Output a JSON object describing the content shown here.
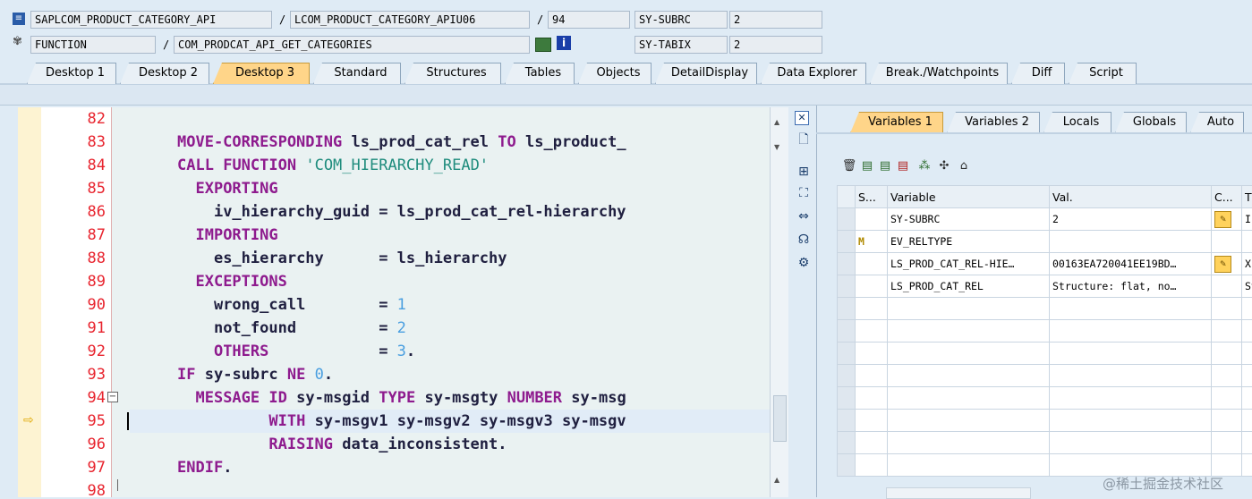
{
  "header": {
    "row1": {
      "program": "SAPLCOM_PRODUCT_CATEGORY_API",
      "include": "LCOM_PRODUCT_CATEGORY_APIU06",
      "line": "94",
      "sysfield": "SY-SUBRC",
      "sysvalue": "2"
    },
    "row2": {
      "type": "FUNCTION",
      "function": "COM_PRODCAT_API_GET_CATEGORIES",
      "sysfield": "SY-TABIX",
      "sysvalue": "2"
    },
    "slash": "/"
  },
  "tabs": [
    {
      "label": "Desktop 1",
      "active": false
    },
    {
      "label": "Desktop 2",
      "active": false
    },
    {
      "label": "Desktop 3",
      "active": true
    },
    {
      "label": "Standard",
      "active": false
    },
    {
      "label": "Structures",
      "active": false
    },
    {
      "label": "Tables",
      "active": false
    },
    {
      "label": "Objects",
      "active": false
    },
    {
      "label": "DetailDisplay",
      "active": false
    },
    {
      "label": "Data Explorer",
      "active": false
    },
    {
      "label": "Break./Watchpoints",
      "active": false
    },
    {
      "label": "Diff",
      "active": false
    },
    {
      "label": "Script",
      "active": false
    }
  ],
  "code": {
    "current_line": "94",
    "lines": [
      {
        "num": "82",
        "text": ""
      },
      {
        "num": "83",
        "text": "MOVE-CORRESPONDING ls_prod_cat_rel TO ls_product_"
      },
      {
        "num": "84",
        "text": "CALL FUNCTION 'COM_HIERARCHY_READ'"
      },
      {
        "num": "85",
        "text": "  EXPORTING"
      },
      {
        "num": "86",
        "text": "    iv_hierarchy_guid = ls_prod_cat_rel-hierarchy"
      },
      {
        "num": "87",
        "text": "  IMPORTING"
      },
      {
        "num": "88",
        "text": "    es_hierarchy      = ls_hierarchy"
      },
      {
        "num": "89",
        "text": "  EXCEPTIONS"
      },
      {
        "num": "90",
        "text": "    wrong_call        = 1"
      },
      {
        "num": "91",
        "text": "    not_found         = 2"
      },
      {
        "num": "92",
        "text": "    OTHERS            = 3."
      },
      {
        "num": "93",
        "text": "IF sy-subrc NE 0."
      },
      {
        "num": "94",
        "text": "  MESSAGE ID sy-msgid TYPE sy-msgty NUMBER sy-msg"
      },
      {
        "num": "95",
        "text": "          WITH sy-msgv1 sy-msgv2 sy-msgv3 sy-msgv"
      },
      {
        "num": "96",
        "text": "          RAISING data_inconsistent."
      },
      {
        "num": "97",
        "text": "ENDIF."
      },
      {
        "num": "98",
        "text": ""
      }
    ]
  },
  "right_tabs": [
    {
      "label": "Variables 1",
      "active": true
    },
    {
      "label": "Variables 2",
      "active": false
    },
    {
      "label": "Locals",
      "active": false
    },
    {
      "label": "Globals",
      "active": false
    },
    {
      "label": "Auto",
      "active": false
    }
  ],
  "variables": {
    "columns": [
      "S...",
      "Variable",
      "Val.",
      "C...",
      "T"
    ],
    "rows": [
      {
        "s": "",
        "variable": "SY-SUBRC",
        "value": "2",
        "change": true,
        "type": "I("
      },
      {
        "s": "M",
        "variable": "EV_RELTYPE",
        "value": "",
        "change": false,
        "type": ""
      },
      {
        "s": "",
        "variable": "LS_PROD_CAT_REL-HIE…",
        "value": "00163EA720041EE19BD…",
        "change": true,
        "type": "X("
      },
      {
        "s": "",
        "variable": "LS_PROD_CAT_REL",
        "value": "Structure: flat, no…",
        "change": false,
        "type": "St"
      }
    ],
    "empty_rows": 8
  },
  "watermark": "@稀土掘金技术社区",
  "colors": {
    "active_tab": "#ffd589",
    "line_number": "#e8242e",
    "keyword": "#8e1b8e",
    "string": "#1f8c7d",
    "number": "#4a9fe0"
  }
}
